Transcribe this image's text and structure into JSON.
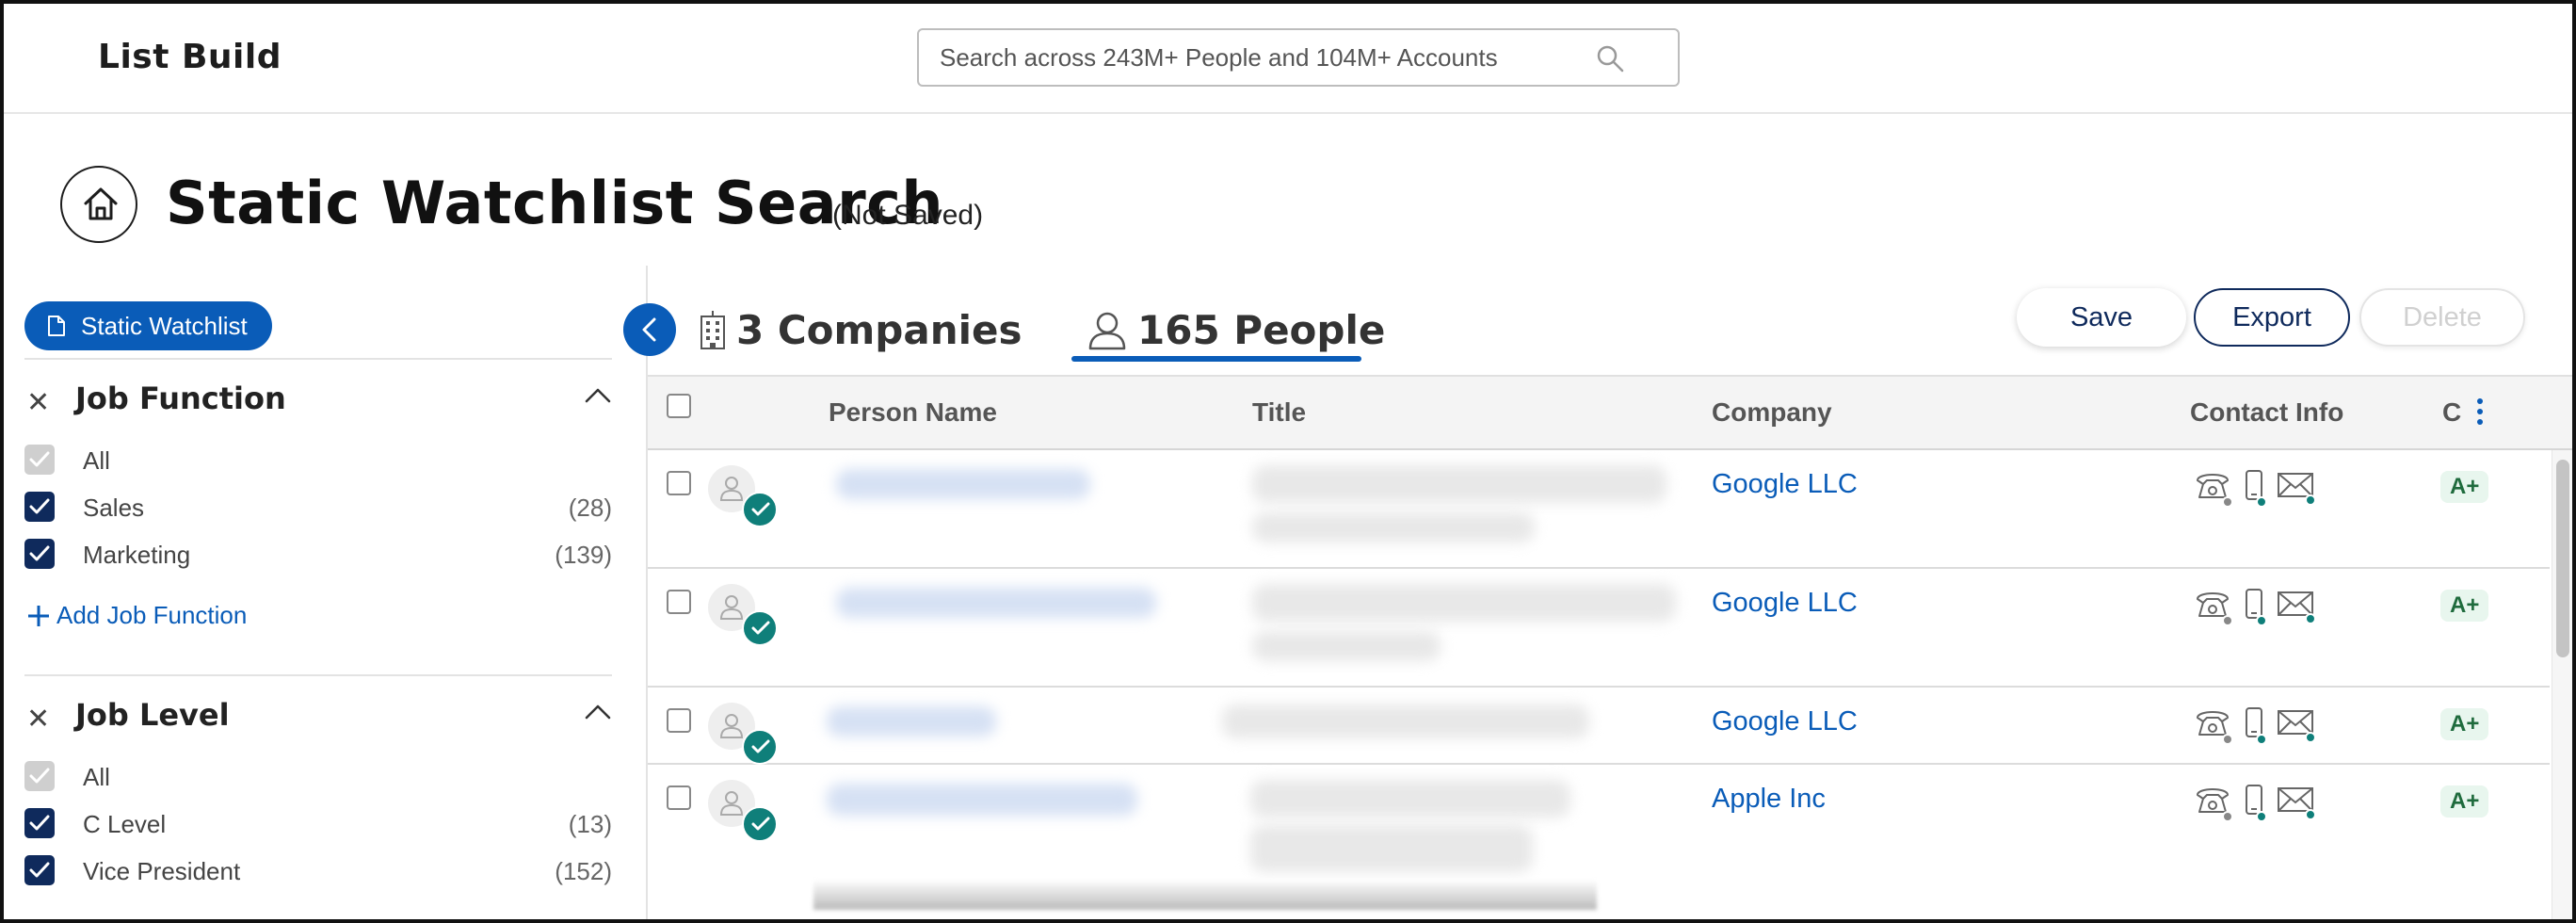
{
  "app": {
    "title": "List Build"
  },
  "search": {
    "placeholder": "Search across 243M+ People and 104M+ Accounts"
  },
  "page": {
    "title": "Static Watchlist Search",
    "subtitle": "(Not Saved)"
  },
  "sidebar": {
    "chip_label": "Static Watchlist",
    "sections": [
      {
        "title": "Job Function",
        "options": [
          {
            "name": "All",
            "count": "",
            "checked": true,
            "disabled": true
          },
          {
            "name": "Sales",
            "count": "(28)",
            "checked": true,
            "disabled": false
          },
          {
            "name": "Marketing",
            "count": "(139)",
            "checked": true,
            "disabled": false
          }
        ],
        "add_label": "Add Job Function"
      },
      {
        "title": "Job Level",
        "options": [
          {
            "name": "All",
            "count": "",
            "checked": true,
            "disabled": true
          },
          {
            "name": "C Level",
            "count": "(13)",
            "checked": true,
            "disabled": false
          },
          {
            "name": "Vice President",
            "count": "(152)",
            "checked": true,
            "disabled": false
          }
        ]
      }
    ]
  },
  "tabs": [
    {
      "label": "3 Companies",
      "active": false
    },
    {
      "label": "165 People",
      "active": true
    }
  ],
  "actions": {
    "save": "Save",
    "export": "Export",
    "delete": "Delete"
  },
  "table": {
    "columns": [
      "Person Name",
      "Title",
      "Company",
      "Contact Info",
      "C"
    ],
    "rows": [
      {
        "company": "Google LLC",
        "grade": "A+"
      },
      {
        "company": "Google LLC",
        "grade": "A+"
      },
      {
        "company": "Google LLC",
        "grade": "A+"
      },
      {
        "company": "Apple Inc",
        "grade": "A+"
      }
    ]
  },
  "colors": {
    "accent": "#0a5cb8",
    "navy": "#0f2a5c",
    "verified": "#0f7f7a",
    "grade_bg": "#e8f6ee"
  },
  "icons": {
    "search": "search-icon",
    "home": "home-icon",
    "document": "document-icon",
    "building": "building-icon",
    "person": "person-icon",
    "phone": "phone-icon",
    "mobile": "mobile-icon",
    "email": "email-icon"
  }
}
